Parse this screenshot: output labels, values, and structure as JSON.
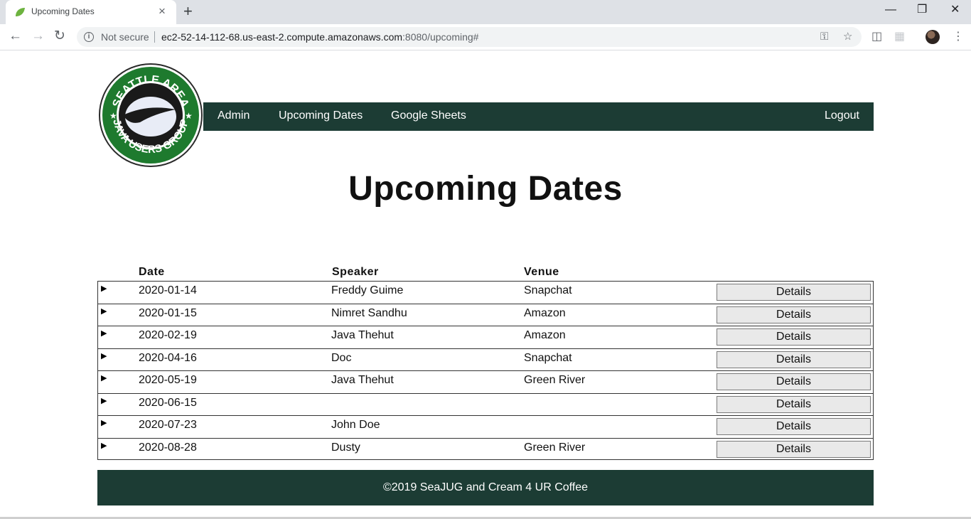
{
  "browser": {
    "tab_title": "Upcoming Dates",
    "tab_close": "×",
    "new_tab": "+",
    "not_secure": "Not secure",
    "url_host": "ec2-52-14-112-68.us-east-2.compute.amazonaws.com",
    "url_rest": ":8080/upcoming#"
  },
  "nav": {
    "admin": "Admin",
    "upcoming": "Upcoming Dates",
    "sheets": "Google Sheets",
    "logout": "Logout"
  },
  "logo": {
    "top_text": "SEATTLE AREA",
    "bottom_text": "JAVA USERS GROUP"
  },
  "page": {
    "title": "Upcoming Dates"
  },
  "table": {
    "headers": {
      "date": "Date",
      "speaker": "Speaker",
      "venue": "Venue"
    },
    "details_label": "Details",
    "rows": [
      {
        "date": "2020-01-14",
        "speaker": "Freddy Guime",
        "venue": "Snapchat"
      },
      {
        "date": "2020-01-15",
        "speaker": "Nimret Sandhu",
        "venue": "Amazon"
      },
      {
        "date": "2020-02-19",
        "speaker": "Java Thehut",
        "venue": "Amazon"
      },
      {
        "date": "2020-04-16",
        "speaker": "Doc",
        "venue": "Snapchat"
      },
      {
        "date": "2020-05-19",
        "speaker": "Java Thehut",
        "venue": "Green River"
      },
      {
        "date": "2020-06-15",
        "speaker": "",
        "venue": ""
      },
      {
        "date": "2020-07-23",
        "speaker": "John Doe",
        "venue": ""
      },
      {
        "date": "2020-08-28",
        "speaker": "Dusty",
        "venue": "Green River"
      }
    ]
  },
  "footer": {
    "text": "©2019 SeaJUG and Cream 4 UR Coffee"
  },
  "colors": {
    "brand_dark_green": "#1c3c34",
    "logo_green": "#1e7a2e"
  }
}
